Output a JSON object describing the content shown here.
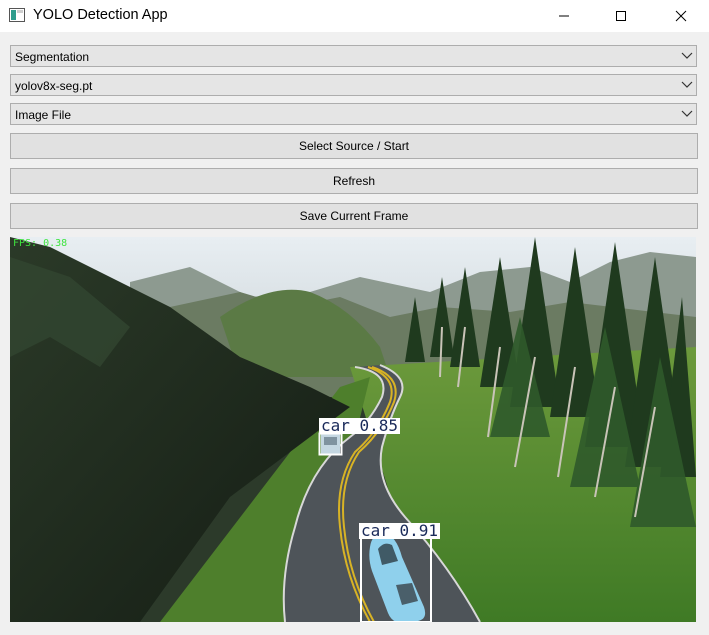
{
  "window": {
    "title": "YOLO Detection App",
    "controls": [
      "minimize",
      "maximize",
      "close"
    ]
  },
  "controls": {
    "task_select": {
      "value": "Segmentation"
    },
    "model_select": {
      "value": "yolov8x-seg.pt"
    },
    "source_select": {
      "value": "Image File"
    },
    "start_button": "Select Source / Start",
    "refresh_button": "Refresh",
    "save_button": "Save Current Frame"
  },
  "video": {
    "fps_text": "FPS: 0.38",
    "detections": [
      {
        "label": "car 0.85",
        "color": "#ffffff"
      },
      {
        "label": "car 0.91",
        "color": "#ffffff"
      }
    ]
  },
  "colors": {
    "window_bg": "#f0f0f0",
    "button_bg": "#e1e1e1",
    "combo_bg": "#e5e5e5",
    "border": "#adadad",
    "fps_text": "#3fe43f"
  }
}
